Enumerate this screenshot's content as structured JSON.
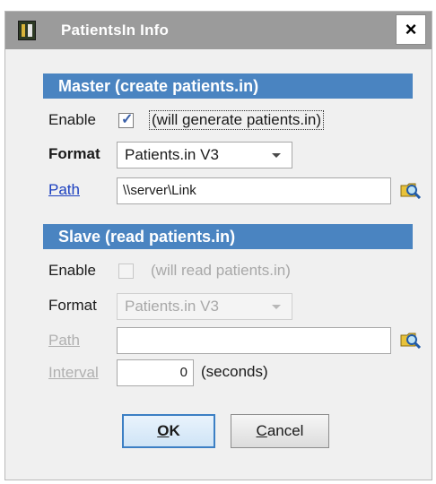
{
  "window": {
    "title": "PatientsIn Info",
    "close_glyph": "×"
  },
  "master": {
    "header": "Master  (create patients.in)",
    "enable_label": "Enable",
    "enable_checked": true,
    "enable_text": "(will generate patients.in)",
    "format_label": "Format",
    "format_value": "Patients.in V3",
    "path_label": "Path",
    "path_value": "\\\\server\\Link",
    "browse_icon": "folder-search-icon"
  },
  "slave": {
    "header": "Slave  (read patients.in)",
    "enable_label": "Enable",
    "enable_checked": false,
    "enable_text": "(will read patients.in)",
    "format_label": "Format",
    "format_value": "Patients.in V3",
    "path_label": "Path",
    "path_value": "",
    "browse_icon": "folder-search-icon",
    "interval_label": "Interval",
    "interval_value": "0",
    "interval_unit": "(seconds)"
  },
  "buttons": {
    "ok_mnemonic": "O",
    "ok_rest": "K",
    "cancel_mnemonic": "C",
    "cancel_rest": "ancel"
  },
  "colors": {
    "section_header": "#4a84c1",
    "titlebar": "#9b9b9b",
    "link": "#1b3fbf"
  }
}
